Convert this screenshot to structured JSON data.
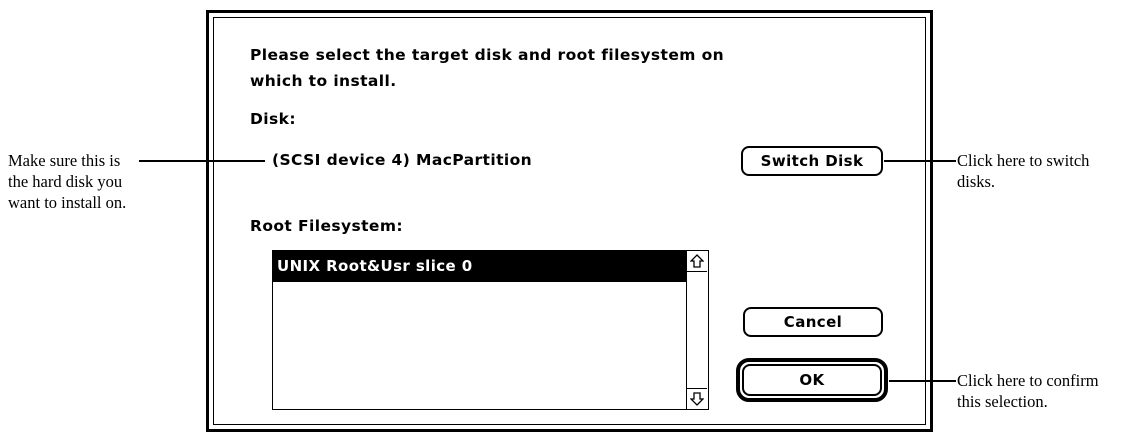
{
  "dialog": {
    "prompt_line1": "Please select the target disk and root filesystem on",
    "prompt_line2": "which to install.",
    "disk_label": "Disk:",
    "disk_value": "(SCSI device 4) MacPartition",
    "switch_disk_label": "Switch Disk",
    "root_fs_label": "Root Filesystem:",
    "filesystems": [
      "UNIX Root&Usr slice 0"
    ],
    "selected_filesystem_index": 0,
    "cancel_label": "Cancel",
    "ok_label": "OK"
  },
  "annotations": {
    "left": [
      "Make sure this is",
      "the hard disk you",
      "want to install on."
    ],
    "switch": [
      "Click here to switch",
      "disks."
    ],
    "ok": [
      "Click here to confirm",
      "this selection."
    ]
  },
  "icons": {
    "scroll_up": "up-arrow-icon",
    "scroll_down": "down-arrow-icon"
  }
}
